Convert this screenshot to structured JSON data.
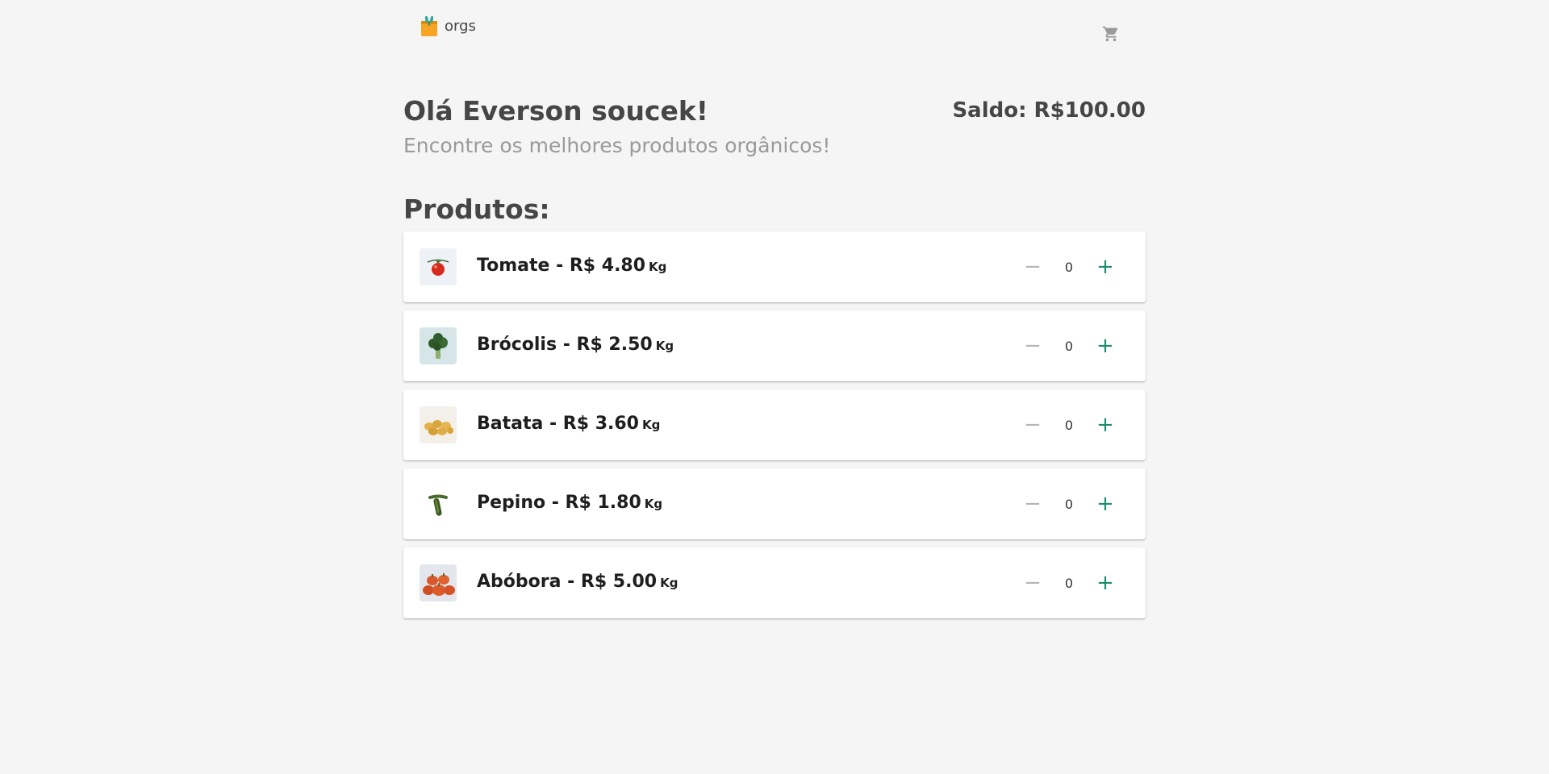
{
  "header": {
    "logo_text": "orgs",
    "cart_icon": "shopping-cart-icon"
  },
  "greeting": {
    "title": "Olá Everson soucek!",
    "balance": "Saldo: R$100.00",
    "subtitle": "Encontre os melhores produtos orgânicos!"
  },
  "products": {
    "section_title": "Produtos:",
    "items": [
      {
        "name_price": "Tomate - R$ 4.80",
        "unit": "Kg",
        "quantity": "0",
        "image": "tomato-image"
      },
      {
        "name_price": "Brócolis - R$ 2.50",
        "unit": "Kg",
        "quantity": "0",
        "image": "broccoli-image"
      },
      {
        "name_price": "Batata - R$ 3.60",
        "unit": "Kg",
        "quantity": "0",
        "image": "potato-image"
      },
      {
        "name_price": "Pepino - R$ 1.80",
        "unit": "Kg",
        "quantity": "0",
        "image": "cucumber-image"
      },
      {
        "name_price": "Abóbora - R$ 5.00",
        "unit": "Kg",
        "quantity": "0",
        "image": "pumpkin-image"
      }
    ],
    "minus_symbol": "−",
    "plus_symbol": "+"
  },
  "colors": {
    "background": "#f5f5f5",
    "text_primary": "#464646",
    "text_muted": "#9a9a9a",
    "accent_plus": "#1f8a6e",
    "minus_grey": "#b5b5b5",
    "logo_orange": "#f6a623",
    "logo_teal": "#2fa89a"
  }
}
